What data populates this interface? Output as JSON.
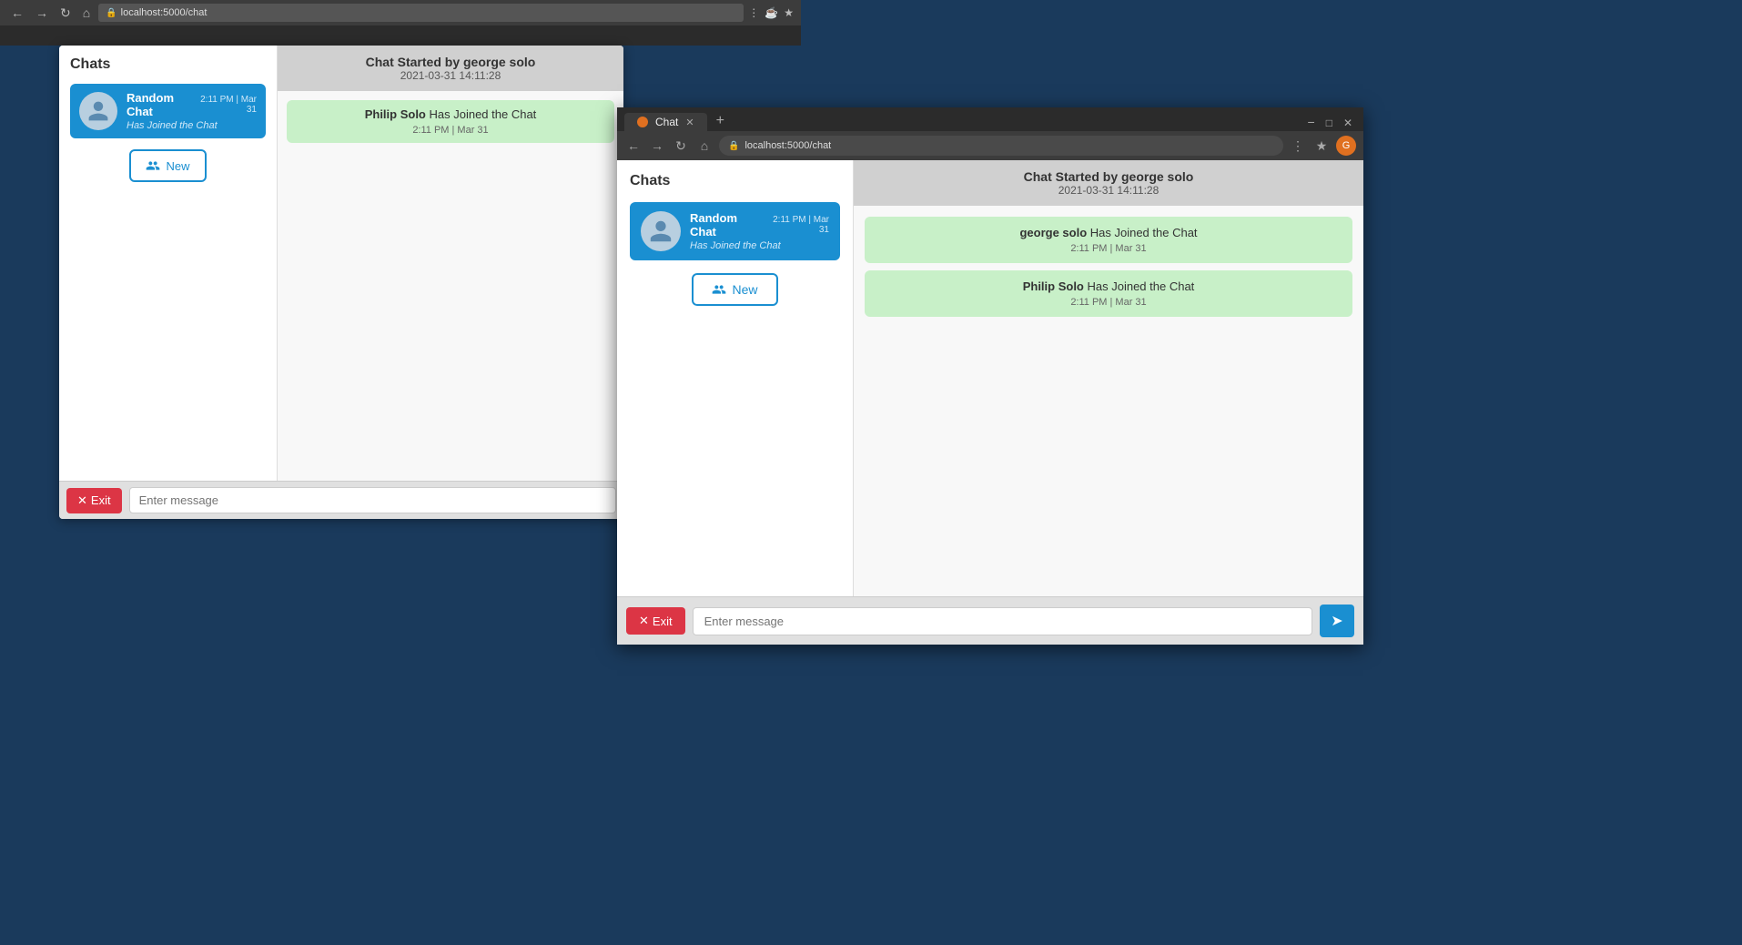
{
  "browser1": {
    "url": "localhost:5000/chat"
  },
  "browser2": {
    "tab_label": "Chat",
    "url": "localhost:5000/chat"
  },
  "window1": {
    "sidebar": {
      "title": "Chats",
      "chat_item": {
        "name": "Random Chat",
        "time": "2:11 PM | Mar 31",
        "status": "Has Joined the Chat"
      },
      "new_button": "New"
    },
    "chat": {
      "header_title": "Chat Started by george solo",
      "header_time": "2021-03-31 14:11:28",
      "messages": [
        {
          "text": "Philip Solo",
          "suffix": " Has Joined the Chat",
          "time": "2:11 PM | Mar 31"
        }
      ],
      "footer": {
        "exit_label": "Exit",
        "input_placeholder": "Enter message"
      }
    }
  },
  "window2": {
    "sidebar": {
      "title": "Chats",
      "chat_item": {
        "name": "Random Chat",
        "time": "2:11 PM | Mar 31",
        "status": "Has Joined the Chat"
      },
      "new_button": "New"
    },
    "chat": {
      "header_title": "Chat Started by george solo",
      "header_time": "2021-03-31 14:11:28",
      "messages": [
        {
          "bold": "george solo",
          "suffix": " Has Joined the Chat",
          "time": "2:11 PM | Mar 31"
        },
        {
          "bold": "Philip Solo",
          "suffix": " Has Joined the Chat",
          "time": "2:11 PM | Mar 31"
        }
      ],
      "footer": {
        "exit_label": "Exit",
        "input_placeholder": "Enter message"
      }
    }
  }
}
